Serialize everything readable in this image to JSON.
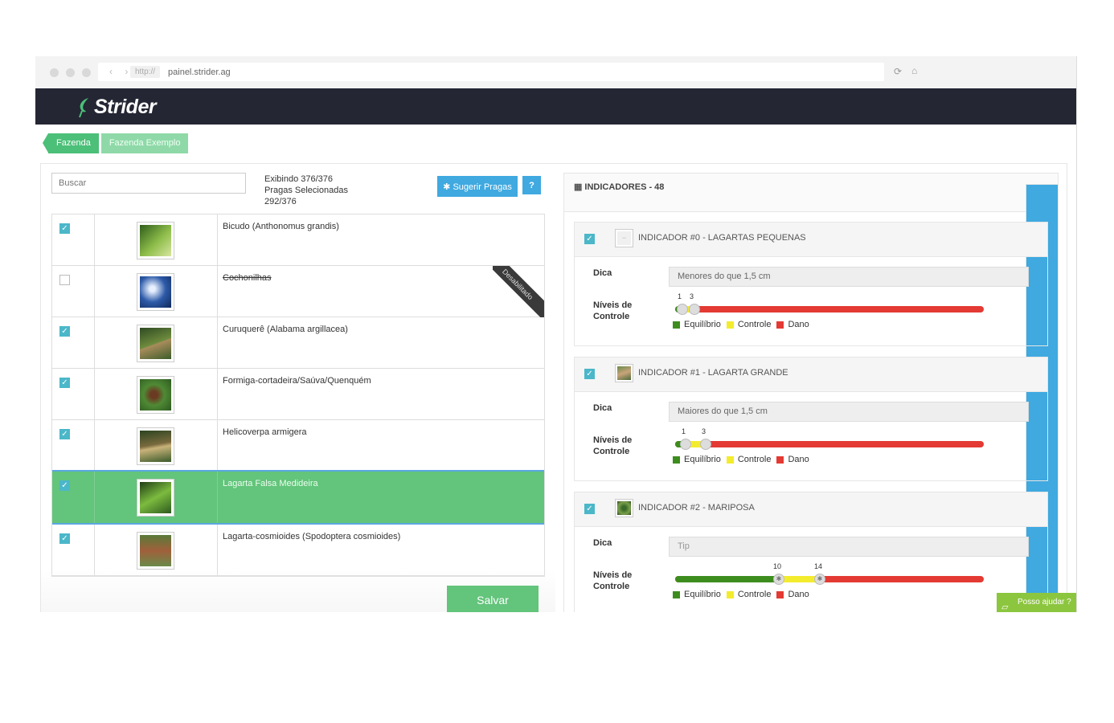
{
  "browser": {
    "protocol": "http://",
    "url": "painel.strider.ag"
  },
  "app": {
    "brand": "Strider"
  },
  "breadcrumb": [
    "Fazenda",
    "Fazenda Exemplo"
  ],
  "search": {
    "placeholder": "Buscar"
  },
  "stats": {
    "showing": "Exibindo 376/376",
    "selected_label": "Pragas Selecionadas",
    "selected_count": "292/376"
  },
  "buttons": {
    "suggest": "Sugerir Pragas",
    "help": "?",
    "save": "Salvar"
  },
  "pests": [
    {
      "name": "Bicudo (Anthonomus grandis)",
      "checked": true
    },
    {
      "name": "Cochonilhas",
      "checked": false,
      "disabled_label": "Desabilitado"
    },
    {
      "name": "Curuquerê (Alabama argillacea)",
      "checked": true
    },
    {
      "name": "Formiga-cortadeira/Saúva/Quenquém",
      "checked": true
    },
    {
      "name": "Helicoverpa armigera",
      "checked": true
    },
    {
      "name": "Lagarta Falsa Medideira",
      "checked": true,
      "selected": true
    },
    {
      "name": "Lagarta-cosmioides (Spodoptera cosmioides)",
      "checked": true
    }
  ],
  "indicators": {
    "title": "INDICADORES - 48",
    "tip_label": "Dica",
    "levels_label": [
      "Níveis de",
      "Controle"
    ],
    "legend": [
      "Equilíbrio",
      "Controle",
      "Dano"
    ],
    "items": [
      {
        "title": "INDICADOR #0 - LAGARTAS PEQUENAS",
        "tip": "Menores do que 1,5 cm",
        "low": "1",
        "high": "3"
      },
      {
        "title": "INDICADOR #1 - LAGARTA GRANDE",
        "tip": "Maiores do que 1,5 cm",
        "low": "1",
        "high": "3"
      },
      {
        "title": "INDICADOR #2 - MARIPOSA",
        "tip": "Tip",
        "low": "10",
        "high": "14"
      }
    ]
  },
  "chat": {
    "label": "Posso ajudar ?"
  },
  "colors": {
    "brand_green": "#63c47b",
    "accent_blue": "#3fa9e0",
    "checkbox": "#4bb7c9",
    "equilibrio": "#3d8d1e",
    "controle": "#f3ec2d",
    "dano": "#e33a33",
    "header_dark": "#242634"
  }
}
